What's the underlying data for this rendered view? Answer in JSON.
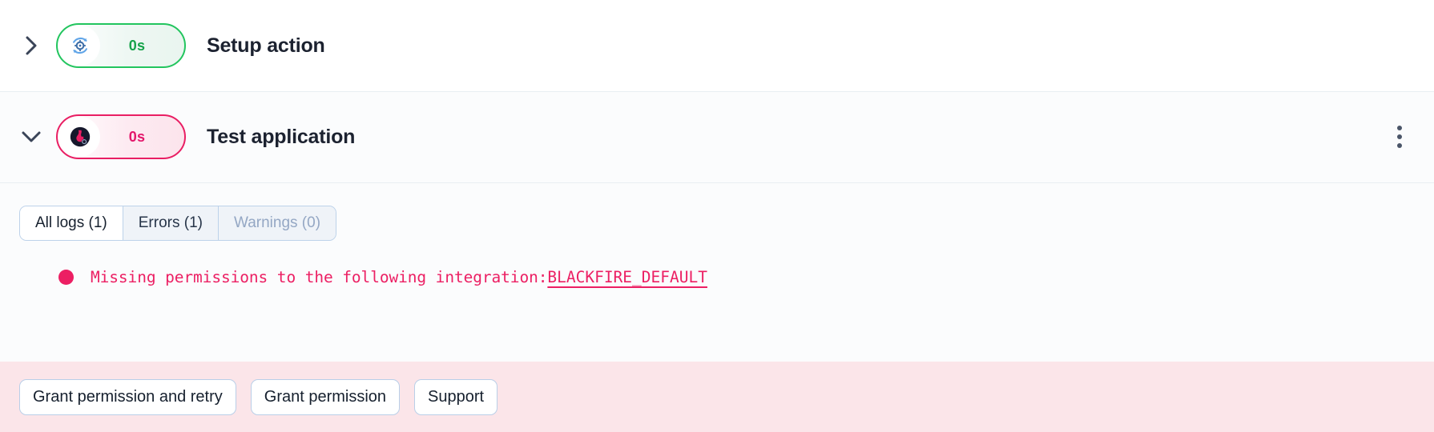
{
  "steps": [
    {
      "name": "setup",
      "expand_icon": "chevron-right-icon",
      "status_icon": "gear-refresh-icon",
      "duration": "0s",
      "title": "Setup action",
      "accent": "#22c55e",
      "has_menu": false
    },
    {
      "name": "test",
      "expand_icon": "chevron-down-icon",
      "status_icon": "blackfire-flame-icon",
      "duration": "0s",
      "title": "Test application",
      "accent": "#e91e63",
      "has_menu": true
    }
  ],
  "logs": {
    "tabs": [
      {
        "label": "All logs (1)",
        "state": "active"
      },
      {
        "label": "Errors (1)",
        "state": "default"
      },
      {
        "label": "Warnings (0)",
        "state": "muted"
      }
    ],
    "entries": [
      {
        "severity": "error",
        "message": "Missing permissions to the following integration: ",
        "link": "BLACKFIRE_DEFAULT",
        "color": "#ec1f63"
      }
    ]
  },
  "action_bar": {
    "background": "#fbe5e9",
    "primary_label": "Grant permission and retry",
    "secondary_label": "Grant permission",
    "support_label": "Support"
  }
}
